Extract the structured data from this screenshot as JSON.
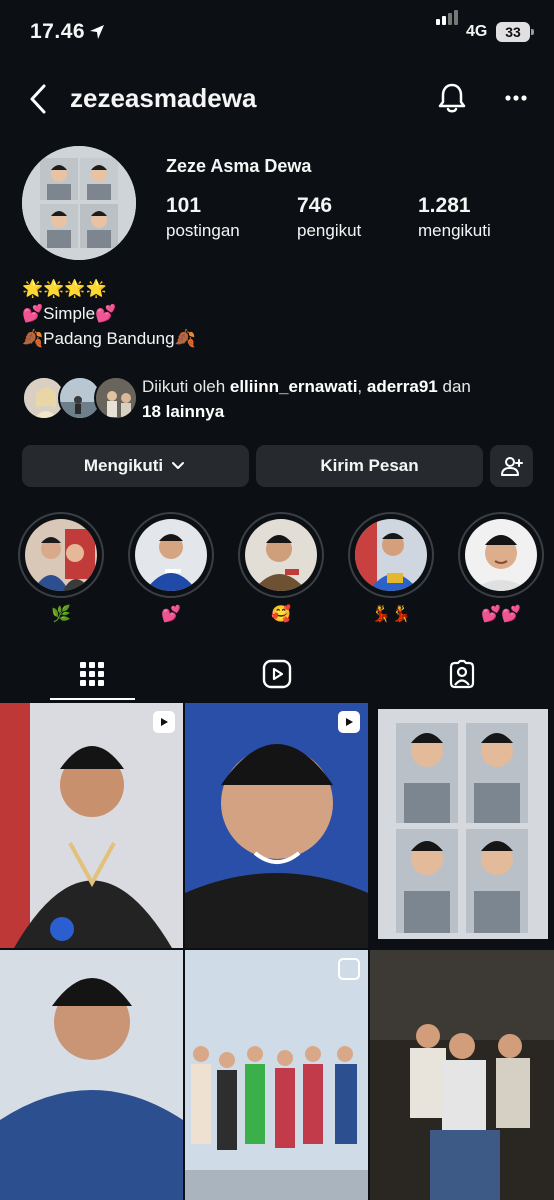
{
  "status": {
    "time": "17.46",
    "network": "4G",
    "battery": "33"
  },
  "header": {
    "username": "zezeasmadewa"
  },
  "profile": {
    "display_name": "Zeze Asma Dewa",
    "stats": [
      {
        "value": "101",
        "label": "postingan"
      },
      {
        "value": "746",
        "label": "pengikut"
      },
      {
        "value": "1.281",
        "label": "mengikuti"
      }
    ],
    "bio": [
      "🌟🌟🌟🌟",
      "💕Simple💕",
      "🍂Padang Bandung🍂"
    ]
  },
  "followed_by": {
    "prefix": "Diikuti oleh ",
    "user1": "elliinn_ernawati",
    "sep": ", ",
    "user2": "aderra91",
    "mid": " dan",
    "others": "18 lainnya"
  },
  "actions": {
    "following": "Mengikuti",
    "message": "Kirim Pesan"
  },
  "highlights": [
    {
      "label": "🌿"
    },
    {
      "label": "💕"
    },
    {
      "label": "🥰"
    },
    {
      "label": "💃💃"
    },
    {
      "label": "💕💕"
    }
  ],
  "tabs": [
    "grid-icon",
    "reels-icon",
    "tagged-icon"
  ],
  "colors": {
    "background": "#0c1014",
    "button": "#262a2f",
    "text": "#f5f5f5"
  }
}
